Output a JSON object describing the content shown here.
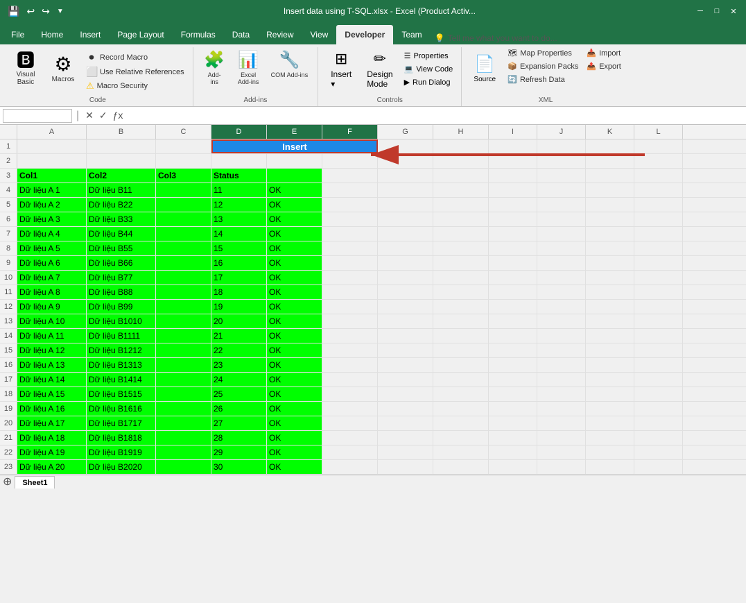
{
  "titlebar": {
    "title": "Insert data using T-SQL.xlsx - Excel (Product Activ...",
    "save_icon": "💾",
    "undo_icon": "↩",
    "redo_icon": "↪"
  },
  "tabs": [
    {
      "label": "File",
      "active": false
    },
    {
      "label": "Home",
      "active": false
    },
    {
      "label": "Insert",
      "active": false
    },
    {
      "label": "Page Layout",
      "active": false
    },
    {
      "label": "Formulas",
      "active": false
    },
    {
      "label": "Data",
      "active": false
    },
    {
      "label": "Review",
      "active": false
    },
    {
      "label": "View",
      "active": false
    },
    {
      "label": "Developer",
      "active": true
    },
    {
      "label": "Team",
      "active": false
    }
  ],
  "tell_me": "Tell me what you want to do...",
  "ribbon": {
    "code_group": {
      "label": "Code",
      "visual_basic_label": "Visual\nBasic",
      "macros_label": "Macros",
      "record_macro": "Record Macro",
      "use_relative": "Use Relative References",
      "macro_security": "Macro Security"
    },
    "addins_group": {
      "label": "Add-ins",
      "add_ins_label": "Add-\nins",
      "excel_label": "Excel\nAdd-ins",
      "com_label": "COM\nAdd-ins"
    },
    "controls_group": {
      "label": "Controls",
      "insert_label": "Insert",
      "design_mode": "Design\nMode",
      "properties": "Properties",
      "view_code": "View Code",
      "run_dialog": "Run Dialog"
    },
    "xml_group": {
      "label": "XML",
      "source_label": "Source",
      "map_properties": "Map Properties",
      "expansion_packs": "Expansion Packs",
      "refresh_data": "Refresh Data",
      "import": "Import",
      "export": "Export"
    }
  },
  "formula_bar": {
    "name_box": "",
    "formula": ""
  },
  "col_headers": [
    "A",
    "B",
    "C",
    "D",
    "E",
    "F",
    "G",
    "H",
    "I",
    "J",
    "K",
    "L"
  ],
  "rows": [
    {
      "num": 1,
      "cells": [
        "",
        "",
        "",
        "",
        "",
        "",
        "",
        "",
        "",
        "",
        "",
        ""
      ]
    },
    {
      "num": 2,
      "cells": [
        "",
        "",
        "",
        "",
        "",
        "",
        "",
        "",
        "",
        "",
        "",
        ""
      ]
    },
    {
      "num": 3,
      "cells": [
        "Col1",
        "Col2",
        "Col3",
        "Status",
        "",
        "",
        "",
        "",
        "",
        "",
        "",
        ""
      ]
    },
    {
      "num": 4,
      "cells": [
        "Dữ liệu A 1",
        "Dữ liệu  B11",
        "",
        "11",
        "OK",
        "",
        "",
        "",
        "",
        "",
        "",
        ""
      ]
    },
    {
      "num": 5,
      "cells": [
        "Dữ liệu A 2",
        "Dữ liệu  B22",
        "",
        "12",
        "OK",
        "",
        "",
        "",
        "",
        "",
        "",
        ""
      ]
    },
    {
      "num": 6,
      "cells": [
        "Dữ liệu A 3",
        "Dữ liệu  B33",
        "",
        "13",
        "OK",
        "",
        "",
        "",
        "",
        "",
        "",
        ""
      ]
    },
    {
      "num": 7,
      "cells": [
        "Dữ liệu A 4",
        "Dữ liệu  B44",
        "",
        "14",
        "OK",
        "",
        "",
        "",
        "",
        "",
        "",
        ""
      ]
    },
    {
      "num": 8,
      "cells": [
        "Dữ liệu A 5",
        "Dữ liệu  B55",
        "",
        "15",
        "OK",
        "",
        "",
        "",
        "",
        "",
        "",
        ""
      ]
    },
    {
      "num": 9,
      "cells": [
        "Dữ liệu A 6",
        "Dữ liệu  B66",
        "",
        "16",
        "OK",
        "",
        "",
        "",
        "",
        "",
        "",
        ""
      ]
    },
    {
      "num": 10,
      "cells": [
        "Dữ liệu A 7",
        "Dữ liệu  B77",
        "",
        "17",
        "OK",
        "",
        "",
        "",
        "",
        "",
        "",
        ""
      ]
    },
    {
      "num": 11,
      "cells": [
        "Dữ liệu A 8",
        "Dữ liệu  B88",
        "",
        "18",
        "OK",
        "",
        "",
        "",
        "",
        "",
        "",
        ""
      ]
    },
    {
      "num": 12,
      "cells": [
        "Dữ liệu A 9",
        "Dữ liệu  B99",
        "",
        "19",
        "OK",
        "",
        "",
        "",
        "",
        "",
        "",
        ""
      ]
    },
    {
      "num": 13,
      "cells": [
        "Dữ liệu A 10",
        "Dữ liệu  B1010",
        "",
        "20",
        "OK",
        "",
        "",
        "",
        "",
        "",
        "",
        ""
      ]
    },
    {
      "num": 14,
      "cells": [
        "Dữ liệu A 11",
        "Dữ liệu  B1111",
        "",
        "21",
        "OK",
        "",
        "",
        "",
        "",
        "",
        "",
        ""
      ]
    },
    {
      "num": 15,
      "cells": [
        "Dữ liệu A 12",
        "Dữ liệu  B1212",
        "",
        "22",
        "OK",
        "",
        "",
        "",
        "",
        "",
        "",
        ""
      ]
    },
    {
      "num": 16,
      "cells": [
        "Dữ liệu A 13",
        "Dữ liệu  B1313",
        "",
        "23",
        "OK",
        "",
        "",
        "",
        "",
        "",
        "",
        ""
      ]
    },
    {
      "num": 17,
      "cells": [
        "Dữ liệu A 14",
        "Dữ liệu  B1414",
        "",
        "24",
        "OK",
        "",
        "",
        "",
        "",
        "",
        "",
        ""
      ]
    },
    {
      "num": 18,
      "cells": [
        "Dữ liệu A 15",
        "Dữ liệu  B1515",
        "",
        "25",
        "OK",
        "",
        "",
        "",
        "",
        "",
        "",
        ""
      ]
    },
    {
      "num": 19,
      "cells": [
        "Dữ liệu A 16",
        "Dữ liệu  B1616",
        "",
        "26",
        "OK",
        "",
        "",
        "",
        "",
        "",
        "",
        ""
      ]
    },
    {
      "num": 20,
      "cells": [
        "Dữ liệu A 17",
        "Dữ liệu  B1717",
        "",
        "27",
        "OK",
        "",
        "",
        "",
        "",
        "",
        "",
        ""
      ]
    },
    {
      "num": 21,
      "cells": [
        "Dữ liệu A 18",
        "Dữ liệu  B1818",
        "",
        "28",
        "OK",
        "",
        "",
        "",
        "",
        "",
        "",
        ""
      ]
    },
    {
      "num": 22,
      "cells": [
        "Dữ liệu A 19",
        "Dữ liệu  B1919",
        "",
        "29",
        "OK",
        "",
        "",
        "",
        "",
        "",
        "",
        ""
      ]
    },
    {
      "num": 23,
      "cells": [
        "Dữ liệu A 20",
        "Dữ liệu  B2020",
        "",
        "30",
        "OK",
        "",
        "",
        "",
        "",
        "",
        "",
        ""
      ]
    }
  ],
  "insert_button_label": "Insert",
  "sheet_tabs": [
    {
      "label": "Sheet1",
      "active": true
    }
  ]
}
